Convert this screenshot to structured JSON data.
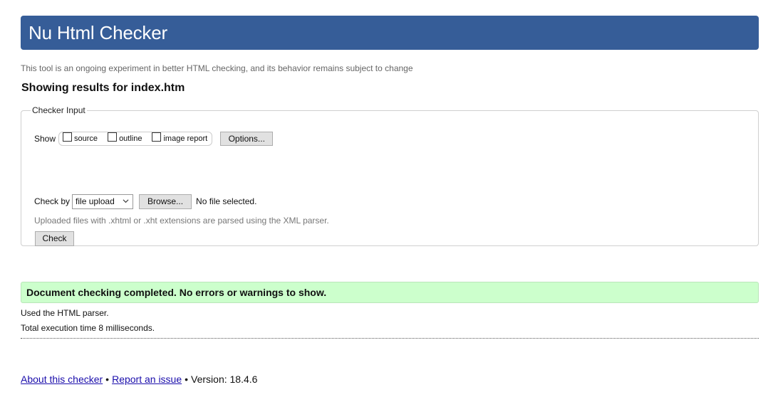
{
  "header": {
    "title": "Nu Html Checker"
  },
  "intro": "This tool is an ongoing experiment in better HTML checking, and its behavior remains subject to change",
  "results_heading": "Showing results for index.htm",
  "checker_input": {
    "legend": "Checker Input",
    "show_label": "Show",
    "show_options": [
      {
        "label": "source",
        "checked": false
      },
      {
        "label": "outline",
        "checked": false
      },
      {
        "label": "image report",
        "checked": false
      }
    ],
    "options_button": "Options...",
    "check_by_label": "Check by",
    "check_by_selected": "file upload",
    "browse_button": "Browse...",
    "file_status": "No file selected.",
    "parser_note": "Uploaded files with .xhtml or .xht extensions are parsed using the XML parser.",
    "check_button": "Check"
  },
  "result": {
    "message": "Document checking completed. No errors or warnings to show.",
    "parser_used": "Used the HTML parser.",
    "execution_time": "Total execution time 8 milliseconds."
  },
  "footer": {
    "about_link": "About this checker",
    "separator": "•",
    "report_link": "Report an issue",
    "version": "Version: 18.4.6"
  },
  "colors": {
    "header_bg": "#365d98",
    "success_bg": "#ccffcc",
    "link": "#1a0dab"
  }
}
